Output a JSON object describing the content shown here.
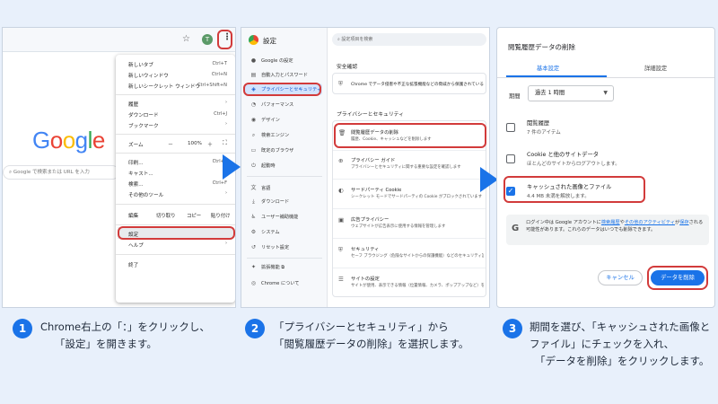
{
  "panel1": {
    "menu": [
      {
        "label": "新しいタブ",
        "shortcut": "Ctrl+T"
      },
      {
        "label": "新しいウィンドウ",
        "shortcut": "Ctrl+N"
      },
      {
        "label": "新しいシークレット ウィンドウ",
        "shortcut": "Ctrl+Shift+N"
      },
      {
        "label": "履歴",
        "shortcut": "›"
      },
      {
        "label": "ダウンロード",
        "shortcut": "Ctrl+J"
      },
      {
        "label": "ブックマーク",
        "shortcut": "›"
      },
      {
        "label": "ズーム",
        "shortcut": ""
      },
      {
        "label": "印刷...",
        "shortcut": "Ctrl+P"
      },
      {
        "label": "キャスト...",
        "shortcut": ""
      },
      {
        "label": "検索...",
        "shortcut": "Ctrl+F"
      },
      {
        "label": "その他のツール",
        "shortcut": "›"
      },
      {
        "label": "設定",
        "shortcut": ""
      },
      {
        "label": "ヘルプ",
        "shortcut": "›"
      },
      {
        "label": "終了",
        "shortcut": ""
      }
    ],
    "zoom": {
      "minus": "－",
      "value": "100%",
      "plus": "＋"
    },
    "edit": {
      "label": "編集",
      "cut": "切り取り",
      "copy": "コピー",
      "paste": "貼り付け"
    },
    "avatar": "T",
    "logo": [
      "G",
      "o",
      "o",
      "g",
      "l",
      "e"
    ],
    "search_placeholder": "Google で検索または URL を入力"
  },
  "panel2": {
    "title": "設定",
    "search_placeholder": "設定項目を検索",
    "sidebar": [
      {
        "icon": "person-icon",
        "glyph": "●",
        "label": "Google の設定"
      },
      {
        "icon": "autofill-icon",
        "glyph": "▤",
        "label": "自動入力とパスワード"
      },
      {
        "icon": "shield-icon",
        "glyph": "◈",
        "label": "プライバシーとセキュリティ"
      },
      {
        "icon": "performance-icon",
        "glyph": "◔",
        "label": "パフォーマンス"
      },
      {
        "icon": "palette-icon",
        "glyph": "◉",
        "label": "デザイン"
      },
      {
        "icon": "search-icon",
        "glyph": "⌕",
        "label": "検索エンジン"
      },
      {
        "icon": "browser-icon",
        "glyph": "▭",
        "label": "既定のブラウザ"
      },
      {
        "icon": "power-icon",
        "glyph": "⏻",
        "label": "起動時"
      },
      {
        "icon": "language-icon",
        "glyph": "文",
        "label": "言語"
      },
      {
        "icon": "download-icon",
        "glyph": "⤓",
        "label": "ダウンロード"
      },
      {
        "icon": "accessibility-icon",
        "glyph": "♿",
        "label": "ユーザー補助機能"
      },
      {
        "icon": "system-icon",
        "glyph": "⚙",
        "label": "システム"
      },
      {
        "icon": "reset-icon",
        "glyph": "↺",
        "label": "リセット設定"
      },
      {
        "icon": "extension-icon",
        "glyph": "✦",
        "label": "拡張機能"
      },
      {
        "icon": "chrome-icon",
        "glyph": "◎",
        "label": "Chrome について"
      }
    ],
    "safety_heading": "安全確認",
    "safety_text": "Chrome でデータ侵害や不正な拡張機能などの脅威から保護されているか",
    "privacy_heading": "プライバシーとセキュリティ",
    "items": [
      {
        "icon": "trash-icon",
        "glyph": "🗑",
        "title": "閲覧履歴データの削除",
        "sub": "履歴、Cookie、キャッシュなどを削除します"
      },
      {
        "icon": "guide-icon",
        "glyph": "⊕",
        "title": "プライバシー ガイド",
        "sub": "プライバシーとセキュリティに関する重要な設定を確認します"
      },
      {
        "icon": "cookie-icon",
        "glyph": "◐",
        "title": "サードパーティ Cookie",
        "sub": "シークレット モードでサードパーティの Cookie がブロックされています"
      },
      {
        "icon": "ads-icon",
        "glyph": "▣",
        "title": "広告プライバシー",
        "sub": "ウェブサイトが広告表示に使用する情報を管理します"
      },
      {
        "icon": "security-icon",
        "glyph": "⛨",
        "title": "セキュリティ",
        "sub": "セーフ ブラウジング（危険なサイトからの保護機能）などのセキュリティ設定"
      },
      {
        "icon": "site-settings-icon",
        "glyph": "☰",
        "title": "サイトの設定",
        "sub": "サイトが使用、表示できる情報（位置情報、カメラ、ポップアップなど）を管理します"
      }
    ]
  },
  "panel3": {
    "title": "閲覧履歴データの削除",
    "tabs": [
      "基本設定",
      "詳細設定"
    ],
    "period_label": "期間",
    "period_value": "過去 1 時間",
    "items": [
      {
        "title": "閲覧履歴",
        "sub": "7 件のアイテム",
        "checked": false
      },
      {
        "title": "Cookie と他のサイトデータ",
        "sub": "ほとんどのサイトからログアウトします。",
        "checked": false
      },
      {
        "title": "キャッシュされた画像とファイル",
        "sub": "4.4 MB 未満を解放します。",
        "checked": true
      }
    ],
    "notice": {
      "pre": "ログイン中は Google アカウントに",
      "link1": "検索履歴",
      "mid": "や",
      "link2": "その他のアクティビティ",
      "post": "が",
      "link3": "保存",
      "tail": "される可能性があります。これらのデータはいつでも削除できます。"
    },
    "cancel": "キャンセル",
    "delete": "データを削除"
  },
  "steps": [
    {
      "num": "1",
      "lines": [
        "Chrome右上の「：」をクリックし、",
        "「設定」を開きます。"
      ]
    },
    {
      "num": "2",
      "lines": [
        "「プライバシーとセキュリティ」から",
        "「閲覧履歴データの削除」を選択します。"
      ]
    },
    {
      "num": "3",
      "lines": [
        "期間を選び、「キャッシュされた画像と",
        "ファイル」にチェックを入れ、",
        "「データを削除」をクリックします。"
      ]
    }
  ],
  "colors": {
    "accent": "#1a73e8",
    "highlight": "#d23b3b"
  }
}
